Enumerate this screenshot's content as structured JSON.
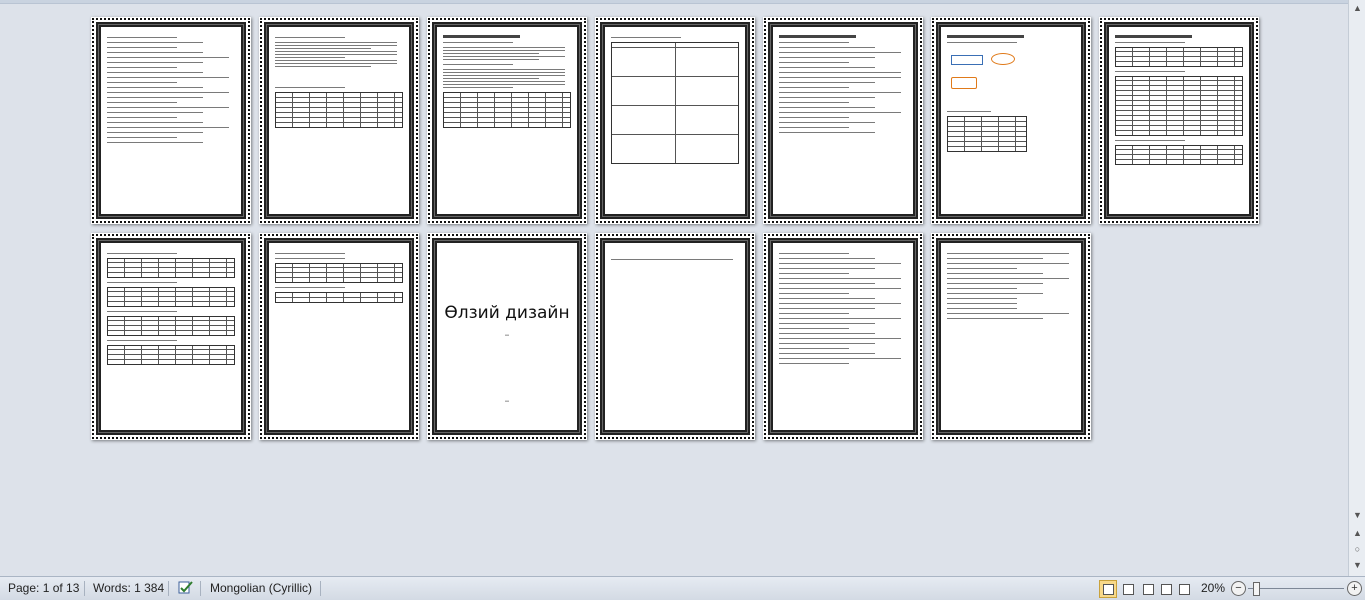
{
  "document": {
    "pages": [
      {
        "row": 1,
        "col": 1,
        "kind": "list"
      },
      {
        "row": 1,
        "col": 2,
        "kind": "text-table"
      },
      {
        "row": 1,
        "col": 3,
        "kind": "text-table"
      },
      {
        "row": 1,
        "col": 4,
        "kind": "big-table"
      },
      {
        "row": 1,
        "col": 5,
        "kind": "text"
      },
      {
        "row": 1,
        "col": 6,
        "kind": "diagram"
      },
      {
        "row": 1,
        "col": 7,
        "kind": "tables"
      },
      {
        "row": 2,
        "col": 1,
        "kind": "tables"
      },
      {
        "row": 2,
        "col": 2,
        "kind": "text-table"
      },
      {
        "row": 2,
        "col": 3,
        "kind": "cover"
      },
      {
        "row": 2,
        "col": 4,
        "kind": "blank"
      },
      {
        "row": 2,
        "col": 5,
        "kind": "list"
      },
      {
        "row": 2,
        "col": 6,
        "kind": "list"
      }
    ],
    "cover_title": "Өлзий дизайн"
  },
  "statusbar": {
    "page": "Page: 1 of 13",
    "words": "Words: 1 384",
    "language": "Mongolian (Cyrillic)",
    "zoom": "20%",
    "zoom_out": "−",
    "zoom_in": "+"
  },
  "scrollbar": {
    "up": "▲",
    "down": "▼",
    "prev": "▲",
    "select": "○",
    "next": "▼"
  }
}
